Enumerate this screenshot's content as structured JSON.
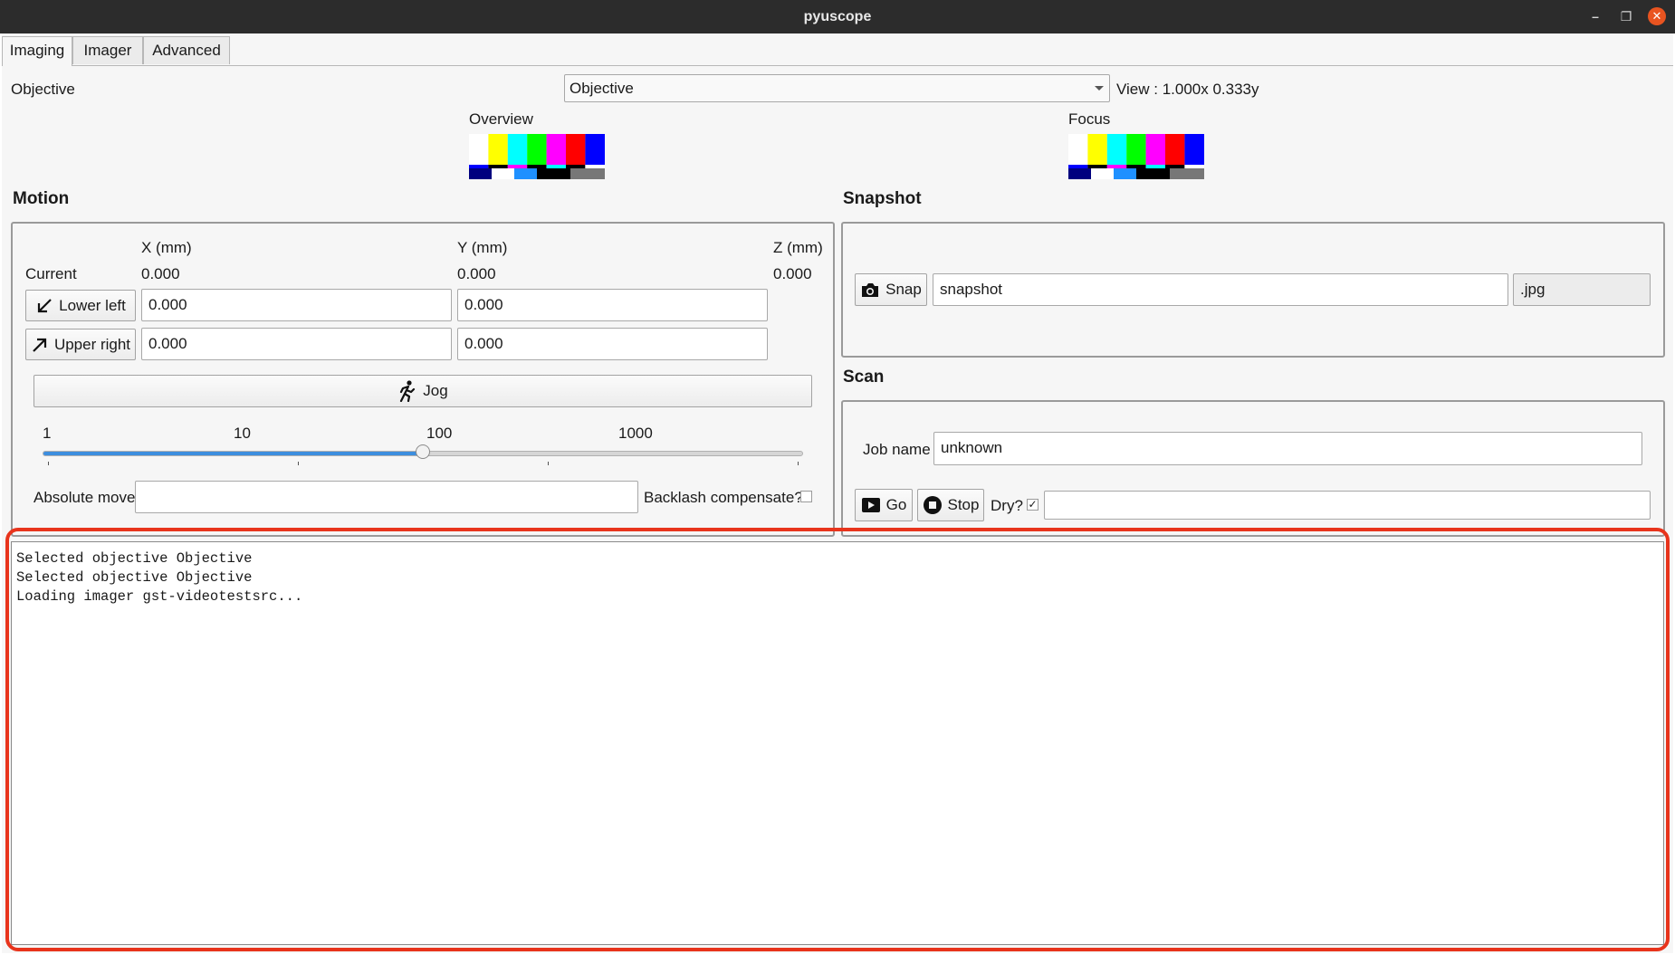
{
  "window": {
    "title": "pyuscope"
  },
  "tabs": [
    {
      "label": "Imaging",
      "active": true
    },
    {
      "label": "Imager",
      "active": false
    },
    {
      "label": "Advanced",
      "active": false
    }
  ],
  "objective": {
    "label": "Objective",
    "selected": "Objective",
    "view": "View : 1.000x 0.333y"
  },
  "previews": {
    "overview": "Overview",
    "focus": "Focus"
  },
  "motion": {
    "title": "Motion",
    "axes": [
      "X (mm)",
      "Y (mm)",
      "Z (mm)"
    ],
    "current_label": "Current",
    "current": [
      "0.000",
      "0.000",
      "0.000"
    ],
    "lower_left": {
      "label": "Lower left",
      "x": "0.000",
      "y": "0.000"
    },
    "upper_right": {
      "label": "Upper right",
      "x": "0.000",
      "y": "0.000"
    },
    "jog_label": "Jog",
    "jog_scale": [
      "1",
      "10",
      "100",
      "1000"
    ],
    "jog_slider_fraction": 0.5,
    "absolute_move_label": "Absolute move",
    "absolute_move_value": "",
    "backlash_label": "Backlash compensate?",
    "backlash_checked": false
  },
  "snapshot": {
    "title": "Snapshot",
    "button": "Snap",
    "filename": "snapshot",
    "extension": ".jpg"
  },
  "scan": {
    "title": "Scan",
    "job_name_label": "Job name",
    "job_name": "unknown",
    "go": "Go",
    "stop": "Stop",
    "dry_label": "Dry?",
    "dry_checked": true,
    "dry_check_glyph": "✓",
    "status": ""
  },
  "log": {
    "lines": [
      "Selected objective Objective",
      "Selected objective Objective",
      "Loading imager gst-videotestsrc..."
    ]
  },
  "colors": {
    "highlight": "#e8341c",
    "slider_fill": "#3d8ede",
    "close_button": "#e95420"
  }
}
